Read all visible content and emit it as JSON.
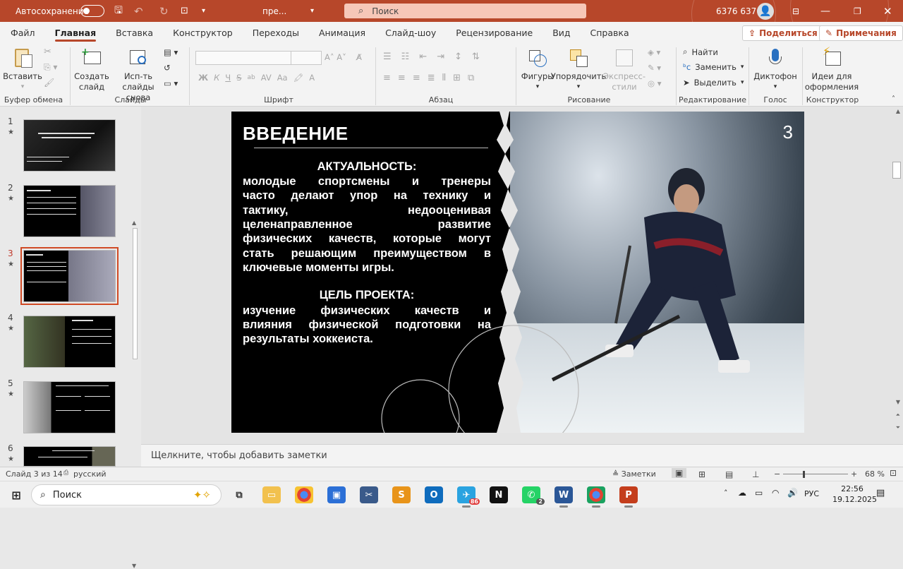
{
  "titlebar": {
    "autosave_label": "Автосохранение",
    "file_name": "пре...",
    "search_placeholder": "Поиск",
    "user_name": "6376 6376"
  },
  "menu": {
    "tabs": [
      "Файл",
      "Главная",
      "Вставка",
      "Конструктор",
      "Переходы",
      "Анимация",
      "Слайд-шоу",
      "Рецензирование",
      "Вид",
      "Справка"
    ],
    "active_tab": "Главная",
    "share_label": "Поделиться",
    "comments_label": "Примечания"
  },
  "ribbon": {
    "paste": "Вставить",
    "new_slide_1": "Создать",
    "new_slide_2": "слайд",
    "reuse_1": "Исп-ть",
    "reuse_2": "слайды снова",
    "shapes": "Фигуры",
    "arrange": "Упорядочить",
    "quick_styles_1": "Экспресс-",
    "quick_styles_2": "стили",
    "find": "Найти",
    "replace": "Заменить",
    "select": "Выделить",
    "dictate": "Диктофон",
    "designer_1": "Идеи для",
    "designer_2": "оформления",
    "groups": {
      "clipboard": "Буфер обмена",
      "slides": "Слайды",
      "font": "Шрифт",
      "paragraph": "Абзац",
      "drawing": "Рисование",
      "editing": "Редактирование",
      "voice": "Голос",
      "designer": "Конструктор"
    },
    "font_buttons": {
      "bold": "Ж",
      "italic": "К",
      "underline": "Ч",
      "strike": "S",
      "spacing": "AV",
      "case": "Aa"
    }
  },
  "thumbnails": [
    {
      "num": "1",
      "star": "★"
    },
    {
      "num": "2",
      "star": "★"
    },
    {
      "num": "3",
      "star": "★"
    },
    {
      "num": "4",
      "star": "★"
    },
    {
      "num": "5",
      "star": "★"
    },
    {
      "num": "6",
      "star": "★"
    }
  ],
  "slide": {
    "heading": "ВВЕДЕНИЕ",
    "number": "3",
    "sub1": "АКТУАЛЬНОСТЬ:",
    "para1_lines": [
      "молодые спортсмены и тренеры",
      "часто делают упор на технику и",
      "тактику, недооценивая",
      "целенаправленное развитие",
      "физических качеств, которые могут",
      "стать решающим преимуществом в",
      "ключевые моменты игры."
    ],
    "sub2": "ЦЕЛЬ ПРОЕКТА:",
    "para2_lines": [
      "изучение физических качеств и",
      "влияния физической подготовки на",
      "результаты хоккеиста."
    ]
  },
  "notes_placeholder": "Щелкните, чтобы добавить заметки",
  "status": {
    "slide_counter": "Слайд 3 из 14",
    "language": "русский",
    "notes_button": "Заметки",
    "zoom_minus": "−",
    "zoom_plus": "+",
    "zoom_level": "68 %"
  },
  "taskbar": {
    "search_label": "Поиск",
    "lang": "РУС",
    "time": "22:56",
    "date": "19.12.2025",
    "telegram_badge": "86",
    "whatsapp_badge": "2"
  },
  "colors": {
    "accent": "#b7472a",
    "selection": "#d04a25"
  }
}
